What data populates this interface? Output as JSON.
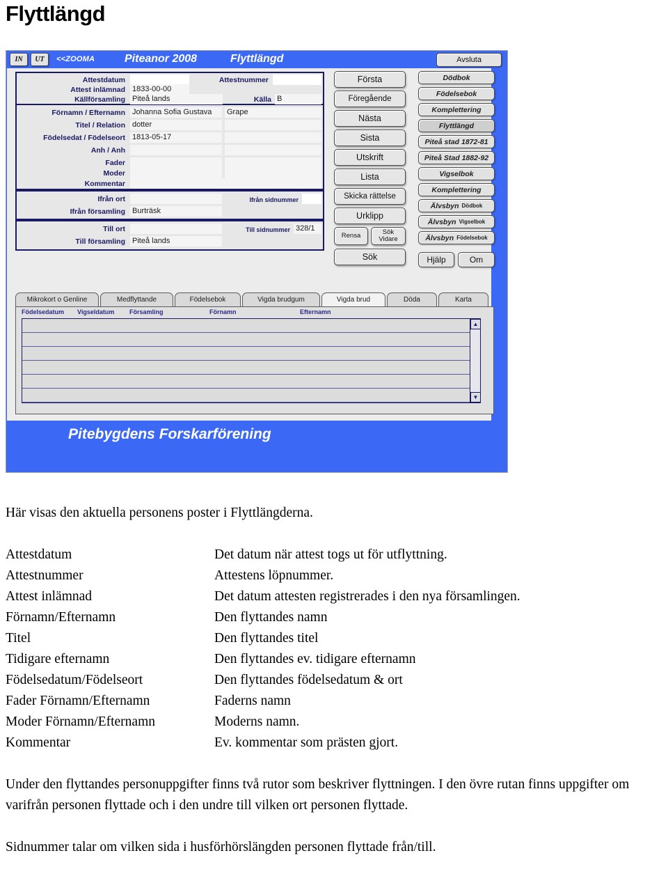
{
  "page": {
    "title": "Flyttlängd"
  },
  "app": {
    "titlebar": {
      "in_label": "IN",
      "ut_label": "UT",
      "zooma_label": "<<ZOOMA",
      "app_name": "Piteanor 2008",
      "section": "Flyttlängd",
      "exit_label": "Avsluta"
    },
    "attest_box": {
      "attestdatum_label": "Attestdatum",
      "attestdatum_value": "",
      "attestnummer_label": "Attestnummer",
      "attestnummer_value": "",
      "attest_inlamnad_label": "Attest inlämnad",
      "attest_inlamnad_value": "1833-00-00",
      "kallforsamling_label": "Källförsamling",
      "kallforsamling_value": "Piteå lands",
      "kalla_label": "Källa",
      "kalla_value": "B"
    },
    "person_box": {
      "fornamn_efternamn_label": "Förnamn  /  Efternamn",
      "fornamn_value": "Johanna Sofia Gustava",
      "efternamn_value": "Grape",
      "titel_relation_label": "Titel  /  Relation",
      "titel_value": "dotter",
      "relation_value": "",
      "fodelsedat_fodelseort_label": "Födelsedat  /  Födelseort",
      "fodelsedat_value": "1813-05-17",
      "fodelseort_value": "",
      "anh_anh_label": "Anh  /  Anh",
      "anh1_value": "",
      "anh2_value": "",
      "fader_label": "Fader",
      "fader_fornamn_value": "",
      "fader_efternamn_value": "",
      "moder_label": "Moder",
      "moder_fornamn_value": "",
      "moder_efternamn_value": "",
      "kommentar_label": "Kommentar",
      "kommentar_value": ""
    },
    "ifran_box": {
      "ifran_ort_label": "Ifrån ort",
      "ifran_ort_value": "",
      "ifran_sidnummer_label": "Ifrån sidnummer",
      "ifran_sidnummer_value": "",
      "ifran_forsamling_label": "Ifrån församling",
      "ifran_forsamling_value": "Burträsk"
    },
    "till_box": {
      "till_ort_label": "Till ort",
      "till_ort_value": "",
      "till_sidnummer_label": "Till sidnummer",
      "till_sidnummer_value": "328/1",
      "till_forsamling_label": "Till församling",
      "till_forsamling_value": "Piteå lands"
    },
    "nav_buttons": [
      {
        "label": "Första"
      },
      {
        "label": "Föregående"
      },
      {
        "label": "Nästa"
      },
      {
        "label": "Sista"
      },
      {
        "label": "Utskrift"
      },
      {
        "label": "Lista"
      },
      {
        "label": "Skicka rättelse"
      },
      {
        "label": "Urklipp"
      }
    ],
    "split_buttons": {
      "rensa_label": "Rensa",
      "sok_vidare_label": "Sök\nVidare",
      "sok_vidare_line1": "Sök",
      "sok_vidare_line2": "Vidare"
    },
    "sok_button": {
      "label": "Sök"
    },
    "book_buttons": [
      {
        "label": "Dödbok",
        "sub": "",
        "active": false
      },
      {
        "label": "Födelsebok",
        "sub": "",
        "active": false
      },
      {
        "label": "Komplettering",
        "sub": "",
        "active": false
      },
      {
        "label": "Flyttlängd",
        "sub": "",
        "active": true
      },
      {
        "label": "Piteå stad 1872-81",
        "sub": "",
        "active": false
      },
      {
        "label": "Piteå Stad 1882-92",
        "sub": "",
        "active": false
      },
      {
        "label": "Vigselbok",
        "sub": "",
        "active": false
      },
      {
        "label": "Komplettering",
        "sub": "",
        "active": false
      },
      {
        "label": "Älvsbyn",
        "sub": "Dödbok",
        "active": false
      },
      {
        "label": "Älvsbyn",
        "sub": "Vigselbok",
        "active": false
      },
      {
        "label": "Älvsbyn",
        "sub": "Födelsebok",
        "active": false
      }
    ],
    "help_buttons": {
      "hjalp_label": "Hjälp",
      "om_label": "Om"
    },
    "tabs": [
      {
        "label": "Mikrokort o Genline",
        "selected": false
      },
      {
        "label": "Medflyttande",
        "selected": false
      },
      {
        "label": "Födelsebok",
        "selected": false
      },
      {
        "label": "Vigda brudgum",
        "selected": false
      },
      {
        "label": "Vigda brud",
        "selected": true
      },
      {
        "label": "Döda",
        "selected": false
      },
      {
        "label": "Karta",
        "selected": false
      }
    ],
    "list": {
      "columns": [
        "Födelsedatum",
        "Vigseldatum",
        "Församling",
        "Förnamn",
        "Efternamn"
      ],
      "rows": [],
      "row_count": 6,
      "scroll_up_icon": "▲",
      "scroll_down_icon": "▼"
    },
    "footer": {
      "text": "Pitebygdens Forskarförening"
    }
  },
  "doc": {
    "intro": "Här visas den aktuella personens poster i Flyttlängderna.",
    "definitions": [
      {
        "term": "Attestdatum",
        "desc": "Det datum när attest togs ut för utflyttning."
      },
      {
        "term": "Attestnummer",
        "desc": "Attestens löpnummer."
      },
      {
        "term": "Attest inlämnad",
        "desc": "Det datum attesten registrerades i den nya församlingen."
      },
      {
        "term": "Förnamn/Efternamn",
        "desc": "Den flyttandes namn"
      },
      {
        "term": "Titel",
        "desc": "Den flyttandes titel"
      },
      {
        "term": "Tidigare efternamn",
        "desc": "Den flyttandes ev. tidigare efternamn"
      },
      {
        "term": "Födelsedatum/Födelseort",
        "desc": "Den flyttandes födelsedatum & ort"
      },
      {
        "term": "Fader Förnamn/Efternamn",
        "desc": "Faderns namn"
      },
      {
        "term": "Moder Förnamn/Efternamn",
        "desc": "Moderns namn."
      },
      {
        "term": "Kommentar",
        "desc": "Ev. kommentar som prästen gjort."
      }
    ],
    "para1": "Under den flyttandes personuppgifter finns två rutor som beskriver flyttningen. I den övre rutan finns uppgifter om varifrån personen flyttade och i den undre till vilken ort personen flyttade.",
    "para2": "Sidnummer talar om vilken sida i husförhörslängden personen flyttade från/till."
  },
  "colors": {
    "banner_blue": "#3b68f5",
    "label_navy": "#1a1a64",
    "window_grey": "#ececec",
    "button_grey": "#e2e2e2"
  }
}
